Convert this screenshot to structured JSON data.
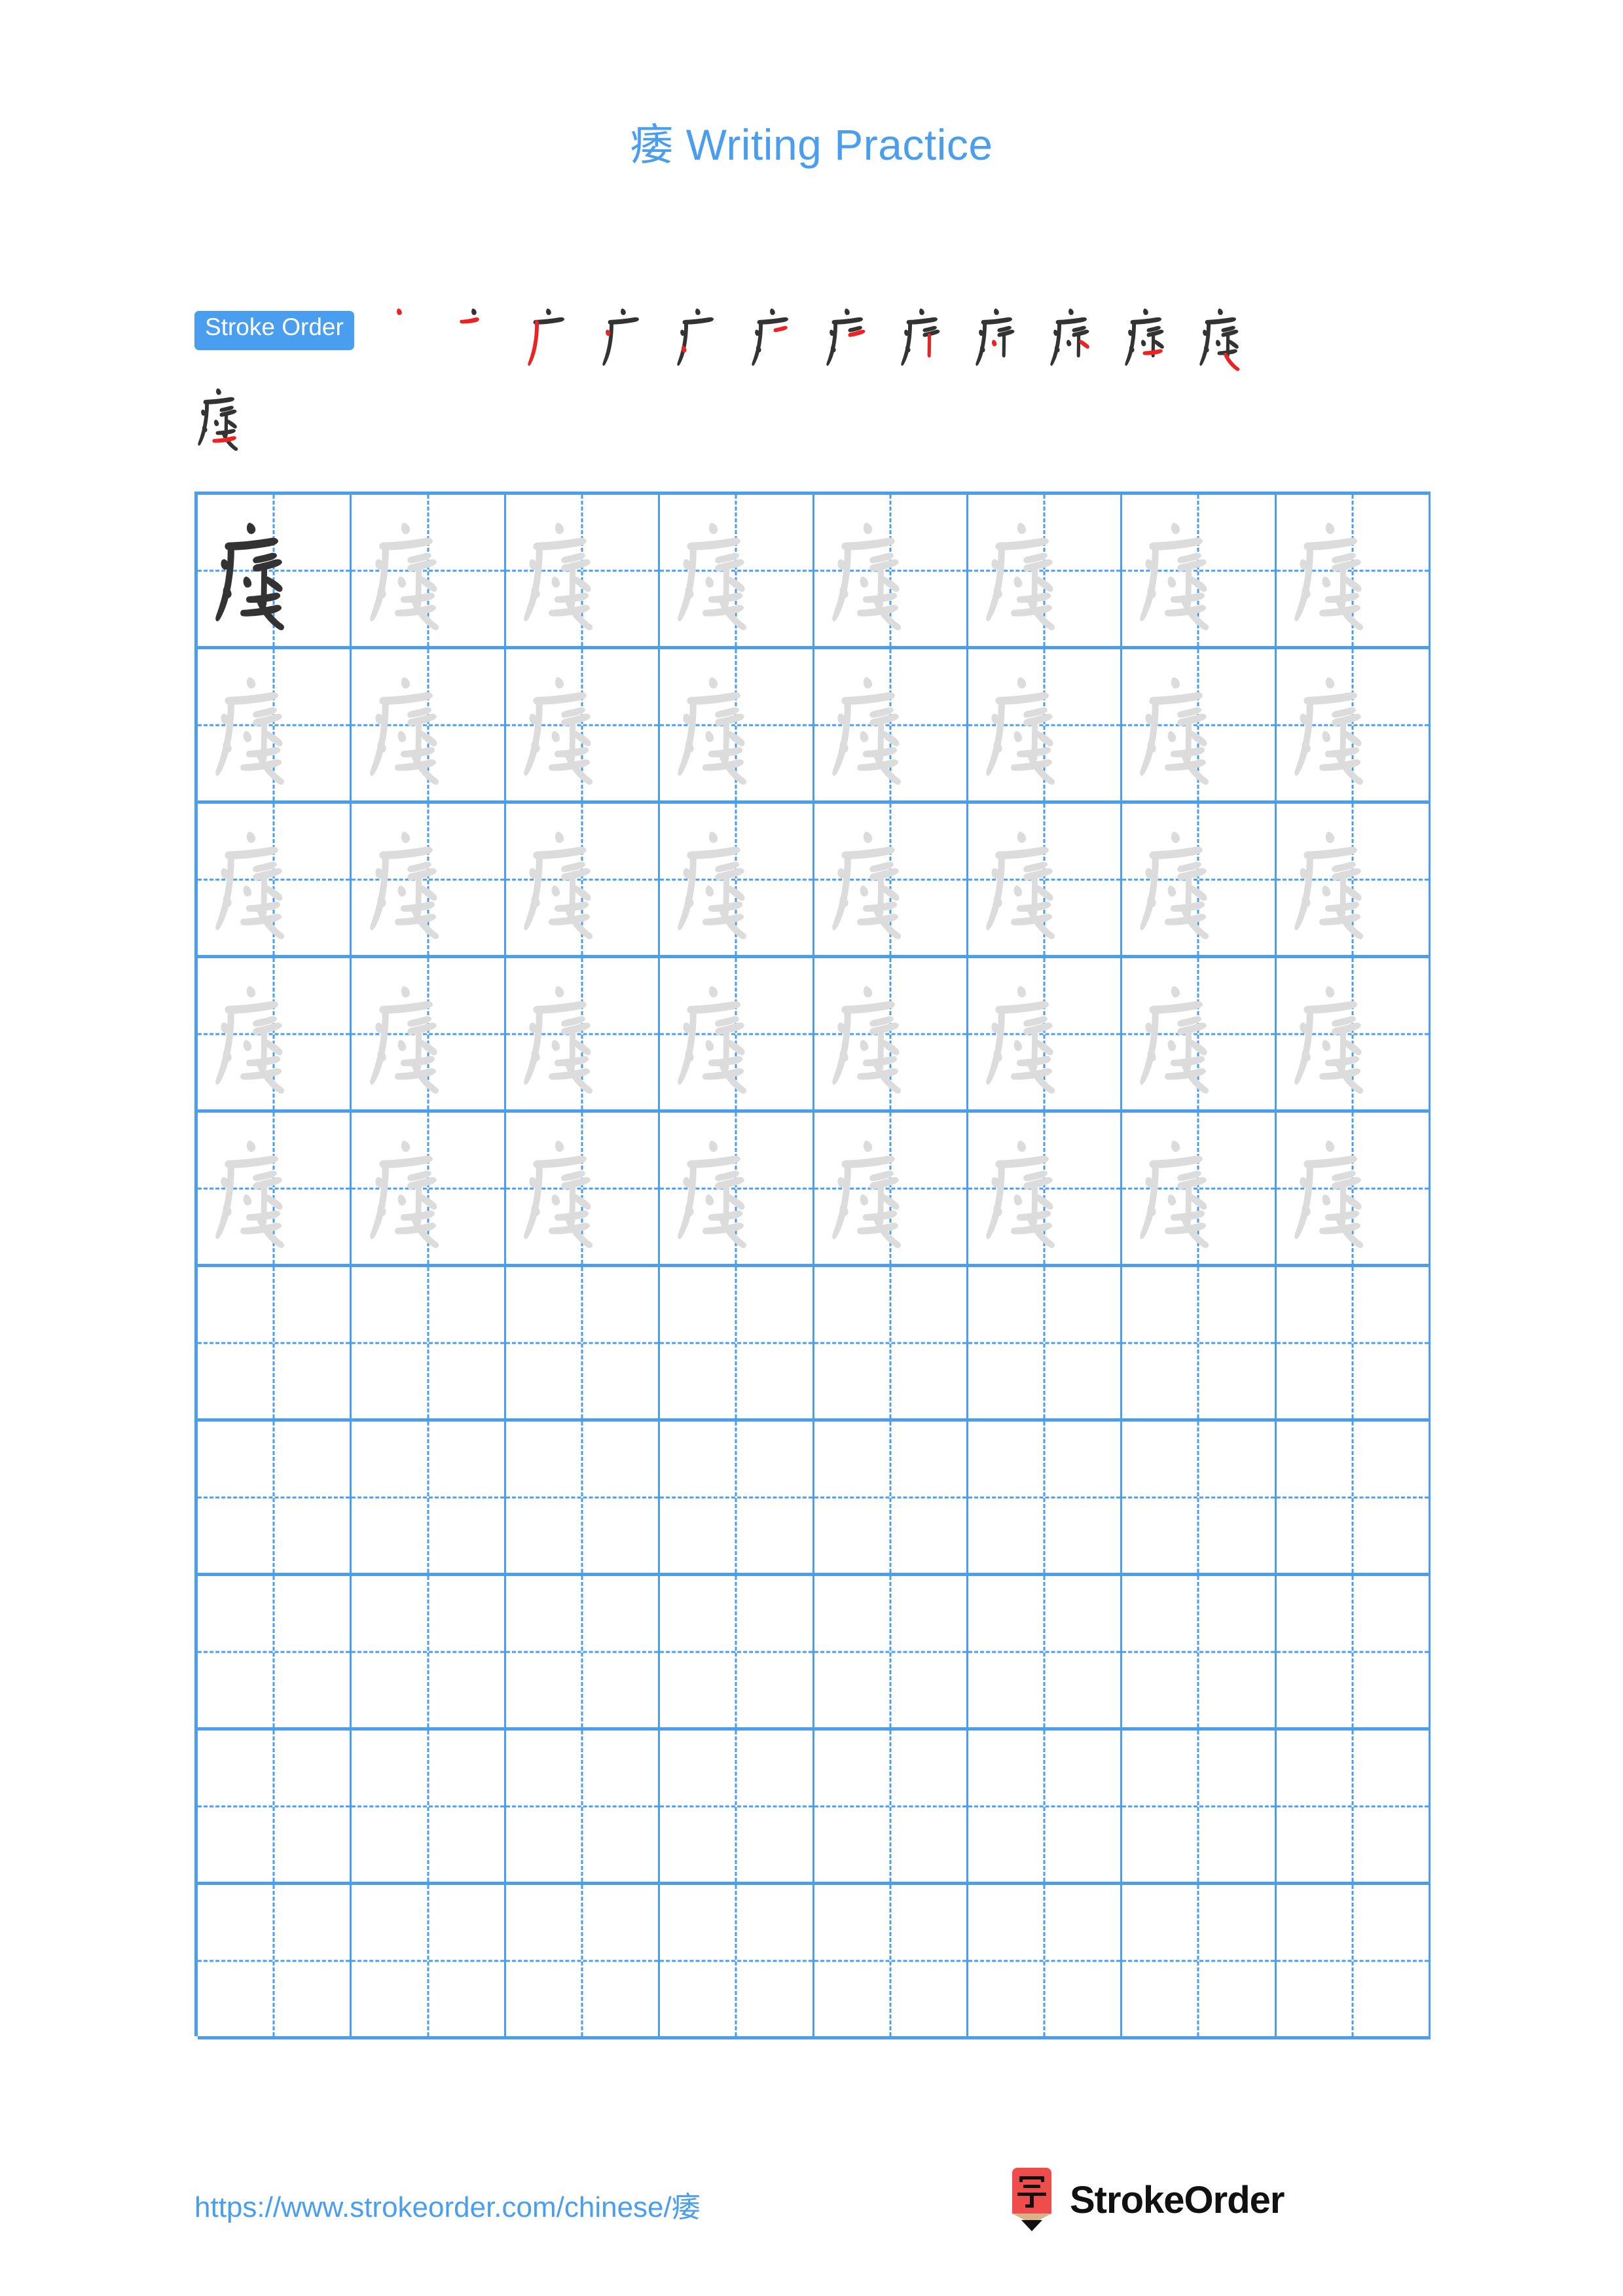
{
  "document": {
    "character": "痿",
    "title": "痿 Writing Practice",
    "title_suffix": "Writing Practice",
    "page_background": "#ffffff",
    "accent_color": "#4a9eef",
    "new_stroke_color": "#ee2222",
    "existing_stroke_color": "#333333",
    "trace_glyph_color": "#dcdcdc"
  },
  "stroke_order": {
    "badge_label": "Stroke Order",
    "total_strokes": 13,
    "row1_count": 12,
    "row2_count": 1,
    "steps": [
      {
        "index": 1,
        "partial": "丶"
      },
      {
        "index": 2,
        "partial": "亠"
      },
      {
        "index": 3,
        "partial": "广"
      },
      {
        "index": 4,
        "partial": "广"
      },
      {
        "index": 5,
        "partial": "疒"
      },
      {
        "index": 6,
        "partial": "疒"
      },
      {
        "index": 7,
        "partial": "疒"
      },
      {
        "index": 8,
        "partial": "疘"
      },
      {
        "index": 9,
        "partial": "疜"
      },
      {
        "index": 10,
        "partial": "疾"
      },
      {
        "index": 11,
        "partial": "疼"
      },
      {
        "index": 12,
        "partial": "痿"
      },
      {
        "index": 13,
        "partial": "痿"
      }
    ]
  },
  "practice_grid": {
    "columns": 8,
    "rows": 10,
    "guide_line_style": "dashed-cross",
    "rows_data": [
      {
        "row": 1,
        "cells": [
          "dark",
          "light",
          "light",
          "light",
          "light",
          "light",
          "light",
          "light"
        ]
      },
      {
        "row": 2,
        "cells": [
          "light",
          "light",
          "light",
          "light",
          "light",
          "light",
          "light",
          "light"
        ]
      },
      {
        "row": 3,
        "cells": [
          "light",
          "light",
          "light",
          "light",
          "light",
          "light",
          "light",
          "light"
        ]
      },
      {
        "row": 4,
        "cells": [
          "light",
          "light",
          "light",
          "light",
          "light",
          "light",
          "light",
          "light"
        ]
      },
      {
        "row": 5,
        "cells": [
          "light",
          "light",
          "light",
          "light",
          "light",
          "light",
          "light",
          "light"
        ]
      },
      {
        "row": 6,
        "cells": [
          "empty",
          "empty",
          "empty",
          "empty",
          "empty",
          "empty",
          "empty",
          "empty"
        ]
      },
      {
        "row": 7,
        "cells": [
          "empty",
          "empty",
          "empty",
          "empty",
          "empty",
          "empty",
          "empty",
          "empty"
        ]
      },
      {
        "row": 8,
        "cells": [
          "empty",
          "empty",
          "empty",
          "empty",
          "empty",
          "empty",
          "empty",
          "empty"
        ]
      },
      {
        "row": 9,
        "cells": [
          "empty",
          "empty",
          "empty",
          "empty",
          "empty",
          "empty",
          "empty",
          "empty"
        ]
      },
      {
        "row": 10,
        "cells": [
          "empty",
          "empty",
          "empty",
          "empty",
          "empty",
          "empty",
          "empty",
          "empty"
        ]
      }
    ]
  },
  "footer": {
    "url": "https://www.strokeorder.com/chinese/痿",
    "logo_text": "StrokeOrder",
    "logo_char": "字",
    "logo_body_color": "#ef4c4c",
    "logo_wood_color": "#d9b48a",
    "logo_tip_color": "#111111"
  }
}
